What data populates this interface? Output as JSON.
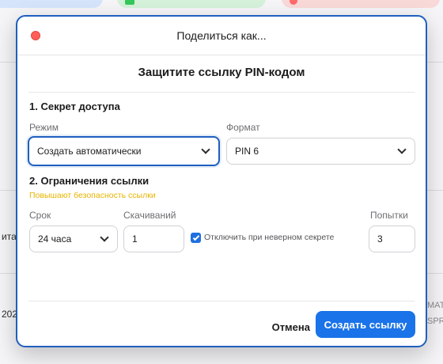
{
  "background": {
    "row_texts": [
      "ита",
      "202"
    ],
    "right_texts": [
      "МАТ",
      "SPR"
    ]
  },
  "dialog": {
    "title": "Поделиться как...",
    "heading": "Защитите ссылку PIN-кодом",
    "section_secret": {
      "title": "1. Секрет доступа",
      "mode_label": "Режим",
      "mode_value": "Создать автоматически",
      "format_label": "Формат",
      "format_value": "PIN 6"
    },
    "section_limits": {
      "title": "2. Ограничения ссылки",
      "hint": "Повышают безопасность ссылки",
      "term_label": "Срок",
      "term_value": "24 часа",
      "downloads_label": "Скачиваний",
      "downloads_value": "1",
      "disable_checkbox_label": "Отключить при неверном секрете",
      "disable_checkbox_checked": true,
      "attempts_label": "Попытки",
      "attempts_value": "3"
    },
    "buttons": {
      "cancel": "Отмена",
      "create": "Создать ссылку"
    }
  },
  "colors": {
    "accent": "#1a73e8",
    "focus_border": "#1f5fbf",
    "hint": "#e8b400",
    "close_dot": "#ff5f57"
  }
}
